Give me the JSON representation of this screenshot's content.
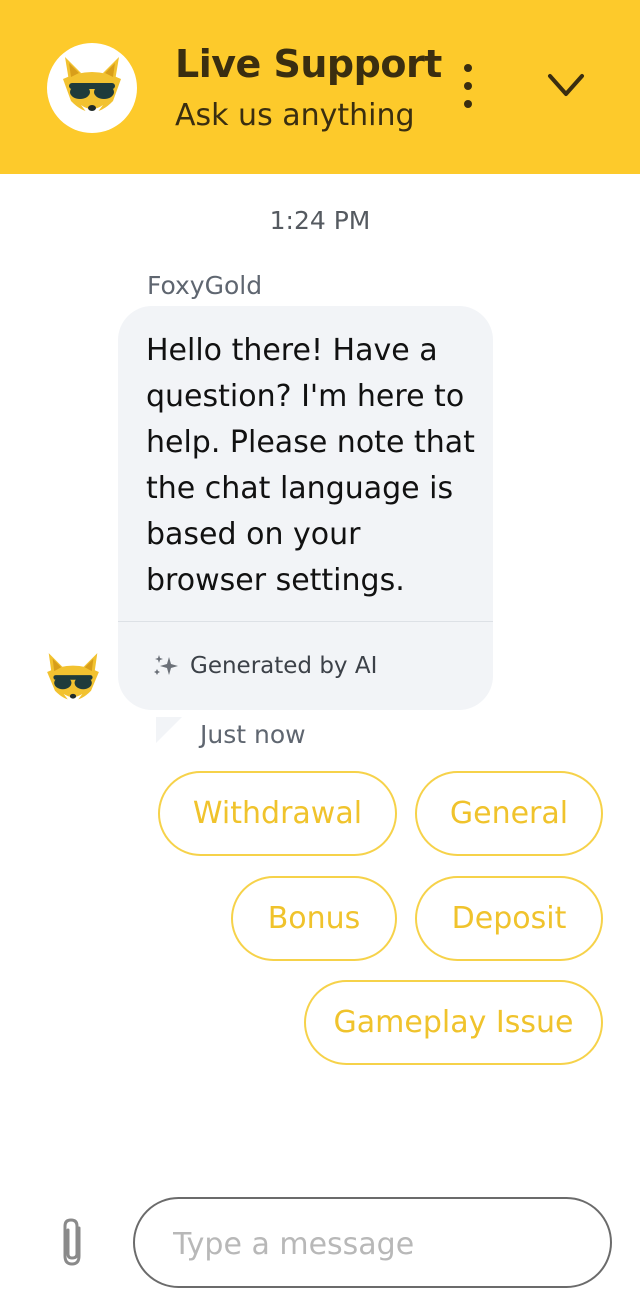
{
  "header": {
    "title": "Live Support",
    "subtitle": "Ask us anything",
    "menu_icon": "more-vertical-icon",
    "collapse_icon": "chevron-down-icon",
    "avatar_icon": "fox-logo-icon"
  },
  "conversation": {
    "timestamp": "1:24 PM",
    "message": {
      "sender": "FoxyGold",
      "text": "Hello there! Have a question? I'm here to help. Please note that the chat language is based on your browser settings.",
      "ai_label": "Generated by AI",
      "ai_icon": "sparkles-icon",
      "status": "Just now"
    },
    "quick_replies": [
      "Withdrawal",
      "General",
      "Bonus",
      "Deposit",
      "Gameplay Issue"
    ]
  },
  "composer": {
    "placeholder": "Type a message",
    "value": "",
    "attach_icon": "paperclip-icon"
  },
  "colors": {
    "brand": "#fdca2b",
    "quick_reply_text": "#f0c32c",
    "quick_reply_border": "#f6d24a",
    "bubble_bg": "#f2f4f7"
  }
}
